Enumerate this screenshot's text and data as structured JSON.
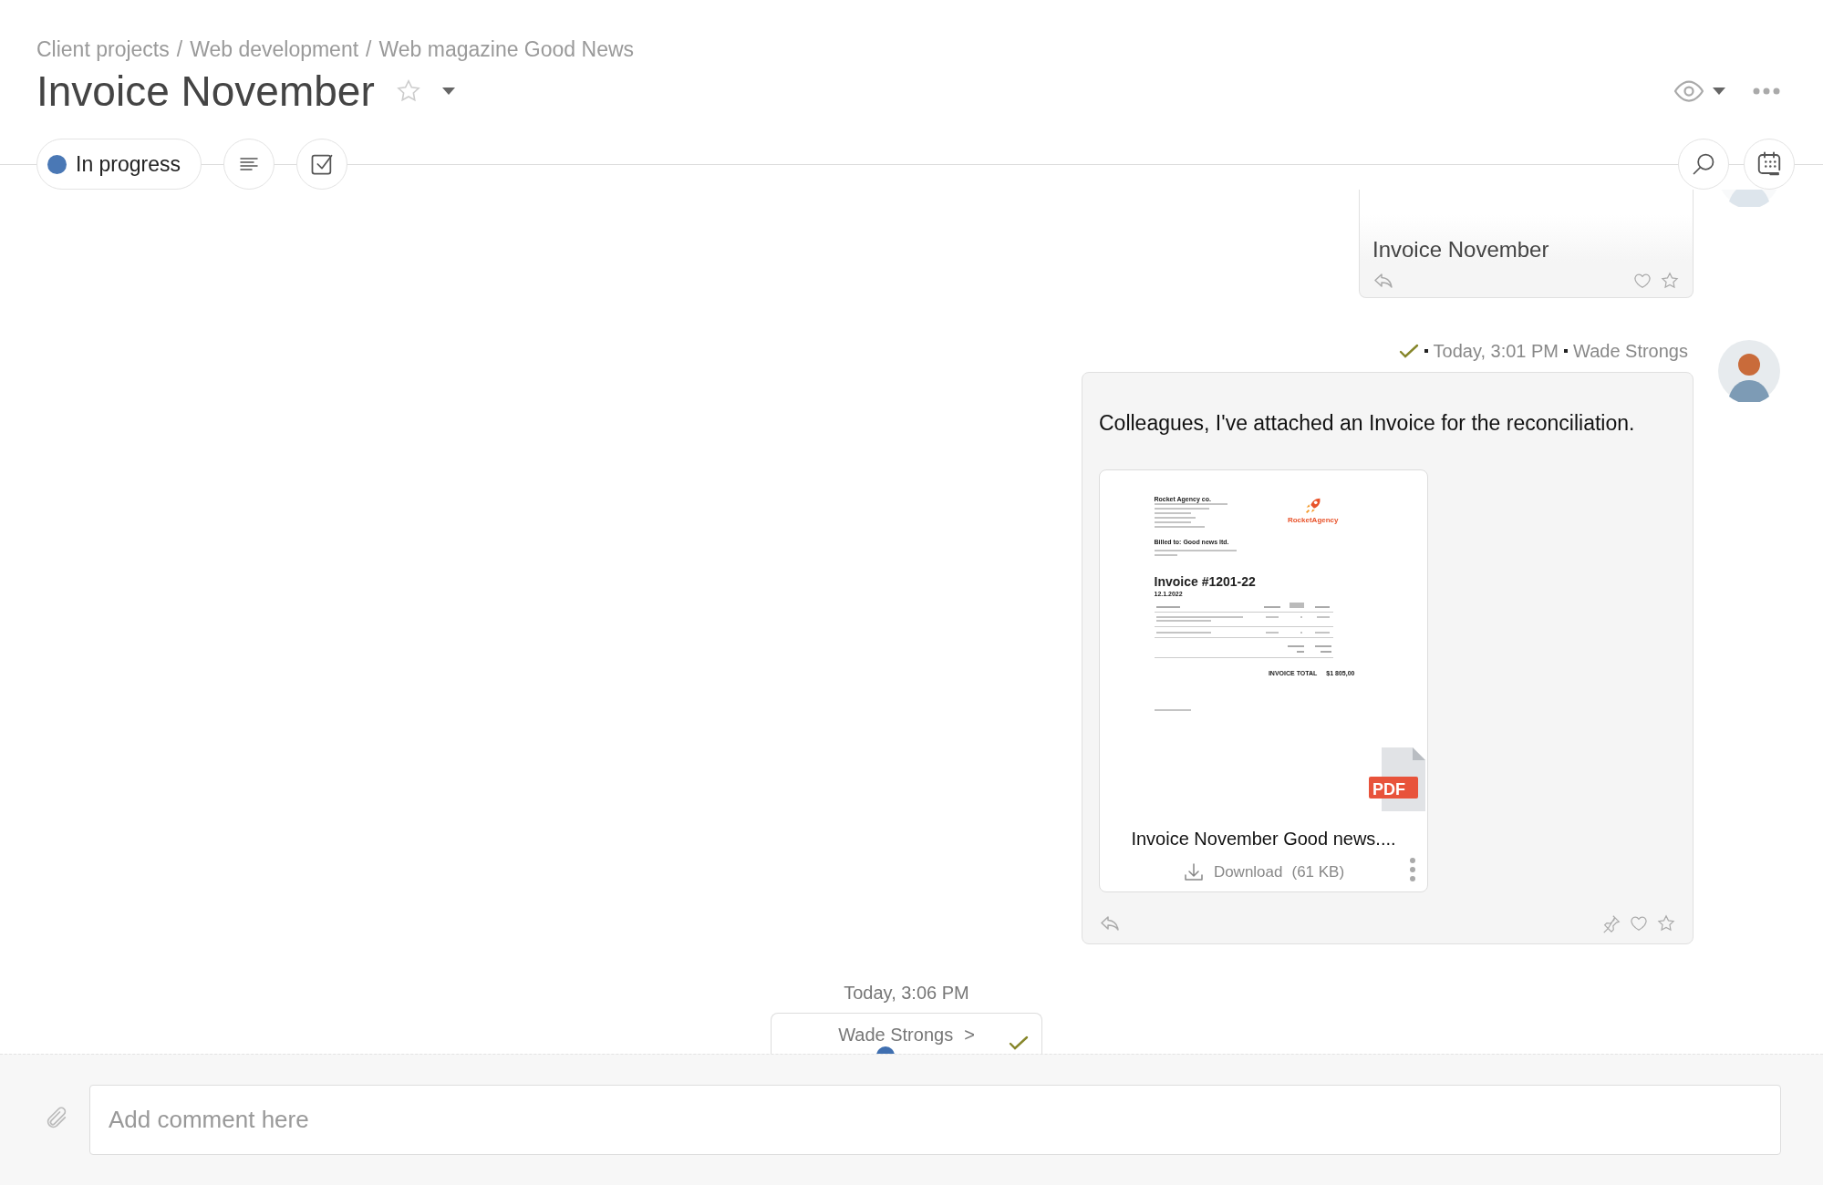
{
  "breadcrumb": {
    "separator": "/",
    "items": [
      "Client projects",
      "Web development",
      "Web magazine Good News"
    ]
  },
  "title": "Invoice November",
  "favorite": false,
  "status": {
    "label": "In progress",
    "color": "#4a78b5"
  },
  "feed": [
    {
      "kind": "excerpt",
      "text": "Invoice November",
      "liked": false,
      "starred": false
    },
    {
      "kind": "message",
      "read": true,
      "time": "Today, 3:01 PM",
      "author": "Wade Strongs",
      "text": "Colleagues, I've attached an Invoice for the reconciliation.",
      "liked": false,
      "starred": false,
      "pinned": false,
      "attachment": {
        "file_type": "PDF",
        "file_name": "Invoice November Good news....",
        "download": "Download",
        "size": "(61 KB)",
        "document": {
          "company": "Rocket Agency co.",
          "logo": "RocketAgency",
          "billed_to": "Billed to: Good news ltd.",
          "heading": "Invoice #1201-22",
          "date": "12.1.2022",
          "total_label": "INVOICE TOTAL",
          "total": "$1 805,00"
        }
      }
    }
  ],
  "event": {
    "time": "Today, 3:06 PM",
    "author": "Wade Strongs",
    "arrow": ">",
    "read": true
  },
  "composer": {
    "placeholder": "Add comment here"
  }
}
